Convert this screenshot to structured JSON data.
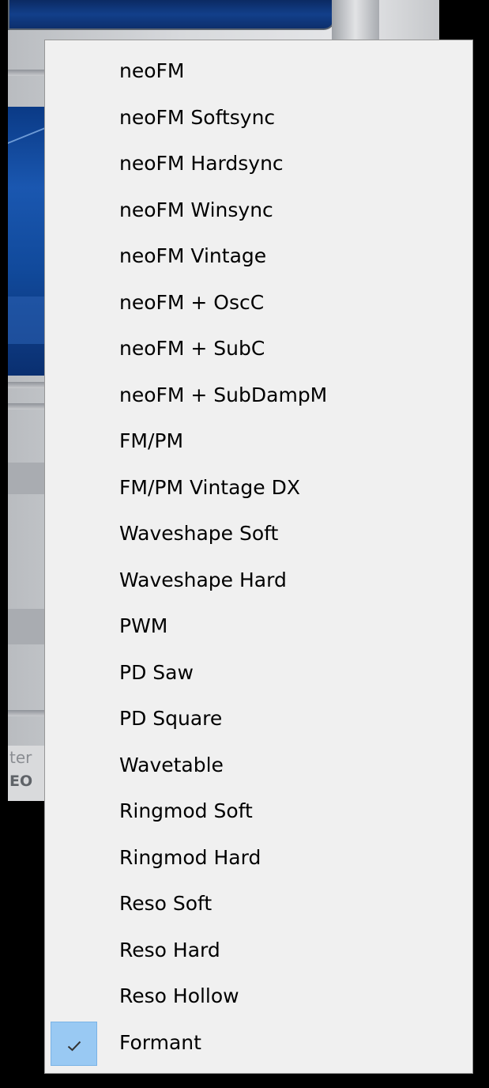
{
  "background": {
    "label_line1": "ter",
    "label_line2": "EO"
  },
  "menu": {
    "items": [
      {
        "label": "neoFM",
        "checked": false
      },
      {
        "label": "neoFM Softsync",
        "checked": false
      },
      {
        "label": "neoFM Hardsync",
        "checked": false
      },
      {
        "label": "neoFM Winsync",
        "checked": false
      },
      {
        "label": "neoFM Vintage",
        "checked": false
      },
      {
        "label": "neoFM + OscC",
        "checked": false
      },
      {
        "label": "neoFM + SubC",
        "checked": false
      },
      {
        "label": "neoFM + SubDampM",
        "checked": false
      },
      {
        "label": "FM/PM",
        "checked": false
      },
      {
        "label": "FM/PM Vintage DX",
        "checked": false
      },
      {
        "label": "Waveshape Soft",
        "checked": false
      },
      {
        "label": "Waveshape Hard",
        "checked": false
      },
      {
        "label": "PWM",
        "checked": false
      },
      {
        "label": "PD Saw",
        "checked": false
      },
      {
        "label": "PD Square",
        "checked": false
      },
      {
        "label": "Wavetable",
        "checked": false
      },
      {
        "label": "Ringmod Soft",
        "checked": false
      },
      {
        "label": "Ringmod Hard",
        "checked": false
      },
      {
        "label": "Reso Soft",
        "checked": false
      },
      {
        "label": "Reso Hard",
        "checked": false
      },
      {
        "label": "Reso Hollow",
        "checked": false
      },
      {
        "label": "Formant",
        "checked": true
      }
    ],
    "check_icon": "checkmark-icon",
    "check_highlight_color": "#99c9f3"
  }
}
